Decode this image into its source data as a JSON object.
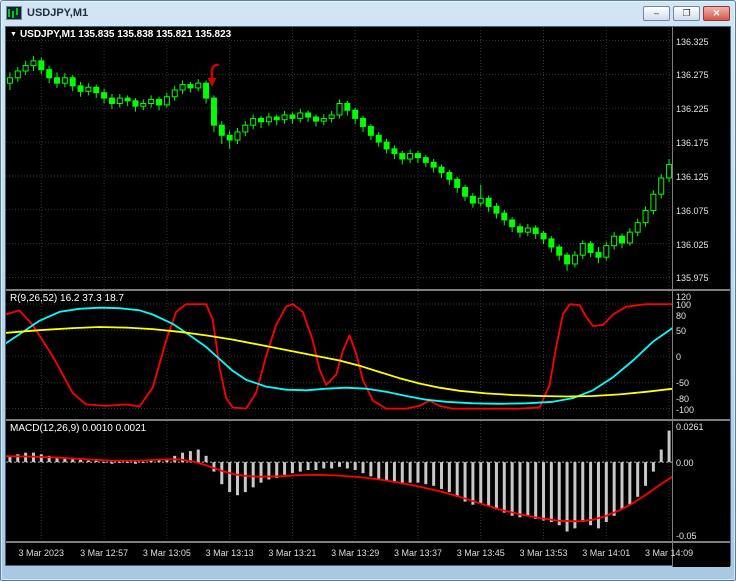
{
  "window": {
    "title": "USDJPY,M1",
    "minimize_label": "–",
    "restore_label": "❐",
    "close_label": "✕"
  },
  "chart": {
    "dropdown_icon": "▼",
    "header": "USDJPY,M1 135.835 135.838 135.821 135.823",
    "price_scale": [
      "136.325",
      "136.275",
      "136.225",
      "136.175",
      "136.125",
      "136.075",
      "136.025",
      "135.975"
    ],
    "time_labels": [
      "3 Mar 2023",
      "3 Mar 12:57",
      "3 Mar 13:05",
      "3 Mar 13:13",
      "3 Mar 13:21",
      "3 Mar 13:29",
      "3 Mar 13:37",
      "3 Mar 13:45",
      "3 Mar 13:53",
      "3 Mar 14:01",
      "3 Mar 14:09"
    ],
    "range": [
      135.958,
      136.345
    ],
    "colors": {
      "candle": "#00FF00",
      "grid": "#333333",
      "arrow": "#D40000"
    },
    "arrow": {
      "index": 26,
      "price": 136.292
    },
    "candles": [
      [
        136.262,
        136.278,
        136.252,
        136.27
      ],
      [
        136.27,
        136.286,
        136.264,
        136.28
      ],
      [
        136.28,
        136.295,
        136.274,
        136.288
      ],
      [
        136.288,
        136.302,
        136.28,
        136.295
      ],
      [
        136.295,
        136.3,
        136.275,
        136.282
      ],
      [
        136.282,
        136.288,
        136.262,
        136.27
      ],
      [
        136.27,
        136.278,
        136.255,
        136.262
      ],
      [
        136.262,
        136.277,
        136.256,
        136.27
      ],
      [
        136.27,
        136.274,
        136.25,
        136.258
      ],
      [
        136.258,
        136.264,
        136.242,
        136.25
      ],
      [
        136.25,
        136.262,
        136.244,
        136.256
      ],
      [
        136.256,
        136.26,
        136.24,
        136.248
      ],
      [
        136.248,
        136.254,
        136.232,
        136.24
      ],
      [
        136.24,
        136.246,
        136.224,
        136.232
      ],
      [
        136.232,
        136.246,
        136.226,
        136.24
      ],
      [
        136.24,
        136.244,
        136.228,
        136.236
      ],
      [
        136.236,
        136.24,
        136.22,
        136.228
      ],
      [
        136.228,
        136.238,
        136.222,
        136.232
      ],
      [
        136.232,
        136.244,
        136.226,
        136.238
      ],
      [
        136.238,
        136.242,
        136.222,
        136.23
      ],
      [
        136.23,
        136.248,
        136.226,
        136.242
      ],
      [
        136.242,
        136.258,
        136.236,
        136.252
      ],
      [
        136.252,
        136.266,
        136.246,
        136.26
      ],
      [
        136.26,
        136.264,
        136.248,
        136.255
      ],
      [
        136.255,
        136.268,
        136.25,
        136.262
      ],
      [
        136.262,
        136.266,
        136.232,
        136.24
      ],
      [
        136.24,
        136.244,
        136.19,
        136.2
      ],
      [
        136.2,
        136.206,
        136.172,
        136.185
      ],
      [
        136.185,
        136.192,
        136.165,
        136.178
      ],
      [
        136.178,
        136.196,
        136.172,
        136.19
      ],
      [
        136.19,
        136.206,
        136.184,
        136.2
      ],
      [
        136.2,
        136.216,
        136.194,
        136.21
      ],
      [
        136.21,
        136.214,
        136.196,
        136.205
      ],
      [
        136.205,
        136.218,
        136.199,
        136.212
      ],
      [
        136.212,
        136.216,
        136.2,
        136.208
      ],
      [
        136.208,
        136.221,
        136.202,
        136.215
      ],
      [
        136.215,
        136.219,
        136.202,
        136.21
      ],
      [
        136.21,
        136.224,
        136.204,
        136.218
      ],
      [
        136.218,
        136.222,
        136.205,
        136.212
      ],
      [
        136.212,
        136.216,
        136.198,
        136.206
      ],
      [
        136.206,
        136.216,
        136.2,
        136.21
      ],
      [
        136.21,
        136.221,
        136.204,
        136.215
      ],
      [
        136.215,
        136.238,
        136.21,
        136.232
      ],
      [
        136.232,
        136.236,
        136.214,
        136.222
      ],
      [
        136.222,
        136.226,
        136.202,
        136.21
      ],
      [
        136.21,
        136.214,
        136.19,
        136.198
      ],
      [
        136.198,
        136.202,
        136.178,
        136.185
      ],
      [
        136.185,
        136.19,
        136.168,
        136.175
      ],
      [
        136.175,
        136.18,
        136.158,
        136.165
      ],
      [
        136.165,
        136.17,
        136.15,
        136.158
      ],
      [
        136.158,
        136.162,
        136.142,
        136.15
      ],
      [
        136.15,
        136.164,
        136.144,
        136.158
      ],
      [
        136.158,
        136.162,
        136.144,
        136.152
      ],
      [
        136.152,
        136.156,
        136.138,
        136.145
      ],
      [
        136.145,
        136.15,
        136.13,
        136.138
      ],
      [
        136.138,
        136.142,
        136.122,
        136.13
      ],
      [
        136.13,
        136.134,
        136.112,
        136.12
      ],
      [
        136.12,
        136.124,
        136.1,
        136.108
      ],
      [
        136.108,
        136.112,
        136.088,
        136.095
      ],
      [
        136.095,
        136.1,
        136.078,
        136.085
      ],
      [
        136.085,
        136.112,
        136.08,
        136.092
      ],
      [
        136.092,
        136.096,
        136.072,
        136.08
      ],
      [
        136.08,
        136.085,
        136.062,
        136.07
      ],
      [
        136.07,
        136.075,
        136.052,
        136.06
      ],
      [
        136.06,
        136.064,
        136.042,
        136.05
      ],
      [
        136.05,
        136.055,
        136.034,
        136.042
      ],
      [
        136.042,
        136.054,
        136.036,
        136.048
      ],
      [
        136.048,
        136.052,
        136.032,
        136.04
      ],
      [
        136.04,
        136.044,
        136.024,
        136.032
      ],
      [
        136.032,
        136.036,
        136.012,
        136.02
      ],
      [
        136.02,
        136.024,
        136.0,
        136.008
      ],
      [
        136.008,
        136.012,
        135.985,
        135.995
      ],
      [
        135.995,
        136.014,
        135.99,
        136.008
      ],
      [
        136.008,
        136.03,
        136.002,
        136.025
      ],
      [
        136.025,
        136.029,
        136.005,
        136.012
      ],
      [
        136.012,
        136.02,
        135.996,
        136.005
      ],
      [
        136.005,
        136.028,
        136.0,
        136.022
      ],
      [
        136.022,
        136.042,
        136.016,
        136.036
      ],
      [
        136.036,
        136.04,
        136.018,
        136.026
      ],
      [
        136.026,
        136.048,
        136.022,
        136.042
      ],
      [
        136.042,
        136.062,
        136.036,
        136.056
      ],
      [
        136.056,
        136.08,
        136.05,
        136.074
      ],
      [
        136.074,
        136.104,
        136.068,
        136.098
      ],
      [
        136.098,
        136.128,
        136.092,
        136.122
      ],
      [
        136.122,
        136.15,
        136.116,
        136.142
      ]
    ]
  },
  "wpr": {
    "label": "R(9,26,52) 16.2 37.3 18.7",
    "scale": [
      "120",
      "100",
      "80",
      "50",
      "0",
      "-50",
      "-80",
      "-100"
    ],
    "gridlines": [
      100,
      50,
      0,
      -50,
      -100
    ],
    "range": [
      -120,
      125
    ],
    "lines": [
      {
        "name": "fast",
        "color": "#FF0000",
        "points": [
          [
            0,
            80
          ],
          [
            0.02,
            88
          ],
          [
            0.04,
            60
          ],
          [
            0.07,
            0
          ],
          [
            0.1,
            -70
          ],
          [
            0.12,
            -92
          ],
          [
            0.15,
            -95
          ],
          [
            0.18,
            -92
          ],
          [
            0.2,
            -96
          ],
          [
            0.22,
            -60
          ],
          [
            0.24,
            30
          ],
          [
            0.255,
            85
          ],
          [
            0.27,
            100
          ],
          [
            0.3,
            100
          ],
          [
            0.31,
            70
          ],
          [
            0.32,
            -20
          ],
          [
            0.33,
            -80
          ],
          [
            0.34,
            -98
          ],
          [
            0.36,
            -100
          ],
          [
            0.375,
            -70
          ],
          [
            0.39,
            0
          ],
          [
            0.405,
            60
          ],
          [
            0.42,
            95
          ],
          [
            0.43,
            100
          ],
          [
            0.445,
            85
          ],
          [
            0.46,
            30
          ],
          [
            0.47,
            -25
          ],
          [
            0.48,
            -55
          ],
          [
            0.495,
            -35
          ],
          [
            0.505,
            10
          ],
          [
            0.515,
            40
          ],
          [
            0.525,
            5
          ],
          [
            0.535,
            -45
          ],
          [
            0.55,
            -85
          ],
          [
            0.57,
            -100
          ],
          [
            0.6,
            -100
          ],
          [
            0.62,
            -95
          ],
          [
            0.635,
            -85
          ],
          [
            0.65,
            -95
          ],
          [
            0.67,
            -100
          ],
          [
            0.72,
            -100
          ],
          [
            0.77,
            -100
          ],
          [
            0.8,
            -98
          ],
          [
            0.815,
            -55
          ],
          [
            0.825,
            20
          ],
          [
            0.835,
            80
          ],
          [
            0.845,
            100
          ],
          [
            0.86,
            98
          ],
          [
            0.87,
            75
          ],
          [
            0.88,
            58
          ],
          [
            0.895,
            60
          ],
          [
            0.91,
            80
          ],
          [
            0.93,
            95
          ],
          [
            0.96,
            100
          ],
          [
            1,
            100
          ]
        ]
      },
      {
        "name": "mid",
        "color": "#00FFFF",
        "points": [
          [
            0,
            25
          ],
          [
            0.02,
            42
          ],
          [
            0.05,
            68
          ],
          [
            0.08,
            85
          ],
          [
            0.11,
            91
          ],
          [
            0.14,
            93
          ],
          [
            0.17,
            92
          ],
          [
            0.2,
            88
          ],
          [
            0.22,
            80
          ],
          [
            0.25,
            62
          ],
          [
            0.27,
            45
          ],
          [
            0.3,
            18
          ],
          [
            0.32,
            -5
          ],
          [
            0.34,
            -28
          ],
          [
            0.36,
            -45
          ],
          [
            0.39,
            -58
          ],
          [
            0.42,
            -64
          ],
          [
            0.45,
            -65
          ],
          [
            0.48,
            -62
          ],
          [
            0.51,
            -60
          ],
          [
            0.54,
            -62
          ],
          [
            0.57,
            -68
          ],
          [
            0.6,
            -76
          ],
          [
            0.63,
            -83
          ],
          [
            0.66,
            -87
          ],
          [
            0.7,
            -90
          ],
          [
            0.74,
            -91
          ],
          [
            0.78,
            -90
          ],
          [
            0.82,
            -87
          ],
          [
            0.85,
            -80
          ],
          [
            0.88,
            -65
          ],
          [
            0.91,
            -40
          ],
          [
            0.94,
            -8
          ],
          [
            0.97,
            28
          ],
          [
            1,
            55
          ]
        ]
      },
      {
        "name": "slow",
        "color": "#FFFF00",
        "points": [
          [
            0,
            45
          ],
          [
            0.05,
            50
          ],
          [
            0.1,
            54
          ],
          [
            0.14,
            56
          ],
          [
            0.18,
            55
          ],
          [
            0.22,
            52
          ],
          [
            0.26,
            47
          ],
          [
            0.3,
            40
          ],
          [
            0.34,
            32
          ],
          [
            0.38,
            22
          ],
          [
            0.42,
            12
          ],
          [
            0.46,
            2
          ],
          [
            0.5,
            -8
          ],
          [
            0.53,
            -18
          ],
          [
            0.56,
            -30
          ],
          [
            0.59,
            -42
          ],
          [
            0.62,
            -52
          ],
          [
            0.65,
            -60
          ],
          [
            0.68,
            -66
          ],
          [
            0.72,
            -71
          ],
          [
            0.76,
            -74
          ],
          [
            0.8,
            -76
          ],
          [
            0.84,
            -77
          ],
          [
            0.88,
            -76
          ],
          [
            0.92,
            -73
          ],
          [
            0.96,
            -68
          ],
          [
            1,
            -62
          ]
        ]
      }
    ]
  },
  "macd": {
    "label": "MACD(12,26,9) 0.0010 0.0021",
    "scale": [
      "0.0261",
      "0.00",
      "-0.05"
    ],
    "range": [
      -0.05,
      0.0261
    ],
    "hist_color": "#C8C8C8",
    "histogram": [
      0.004,
      0.005,
      0.006,
      0.006,
      0.005,
      0.004,
      0.003,
      0.003,
      0.002,
      0.002,
      0.001,
      0.001,
      0,
      -0.001,
      0,
      0,
      -0.001,
      0,
      0.001,
      0.001,
      0.002,
      0.004,
      0.006,
      0.007,
      0.008,
      0.004,
      -0.006,
      -0.014,
      -0.019,
      -0.021,
      -0.019,
      -0.016,
      -0.013,
      -0.011,
      -0.01,
      -0.008,
      -0.007,
      -0.006,
      -0.005,
      -0.005,
      -0.004,
      -0.004,
      -0.003,
      -0.004,
      -0.005,
      -0.007,
      -0.009,
      -0.011,
      -0.012,
      -0.013,
      -0.014,
      -0.013,
      -0.013,
      -0.014,
      -0.015,
      -0.017,
      -0.019,
      -0.022,
      -0.025,
      -0.027,
      -0.026,
      -0.028,
      -0.03,
      -0.032,
      -0.034,
      -0.035,
      -0.034,
      -0.036,
      -0.037,
      -0.038,
      -0.04,
      -0.044,
      -0.042,
      -0.038,
      -0.04,
      -0.042,
      -0.038,
      -0.034,
      -0.03,
      -0.027,
      -0.022,
      -0.015,
      -0.006,
      0.008,
      0.02
    ],
    "signal": {
      "color": "#FF0000",
      "points": [
        [
          0,
          0.0038
        ],
        [
          0.04,
          0.0035
        ],
        [
          0.08,
          0.0028
        ],
        [
          0.12,
          0.0018
        ],
        [
          0.16,
          0.001
        ],
        [
          0.2,
          0.001
        ],
        [
          0.23,
          0.0016
        ],
        [
          0.26,
          0.0018
        ],
        [
          0.28,
          0.0005
        ],
        [
          0.3,
          -0.002
        ],
        [
          0.32,
          -0.005
        ],
        [
          0.34,
          -0.0075
        ],
        [
          0.36,
          -0.0088
        ],
        [
          0.38,
          -0.0092
        ],
        [
          0.41,
          -0.009
        ],
        [
          0.44,
          -0.0082
        ],
        [
          0.47,
          -0.008
        ],
        [
          0.5,
          -0.0085
        ],
        [
          0.53,
          -0.0095
        ],
        [
          0.56,
          -0.011
        ],
        [
          0.59,
          -0.013
        ],
        [
          0.62,
          -0.0155
        ],
        [
          0.65,
          -0.0185
        ],
        [
          0.68,
          -0.022
        ],
        [
          0.71,
          -0.026
        ],
        [
          0.74,
          -0.03
        ],
        [
          0.77,
          -0.033
        ],
        [
          0.8,
          -0.0355
        ],
        [
          0.83,
          -0.0372
        ],
        [
          0.86,
          -0.0375
        ],
        [
          0.88,
          -0.0365
        ],
        [
          0.9,
          -0.034
        ],
        [
          0.92,
          -0.0305
        ],
        [
          0.94,
          -0.026
        ],
        [
          0.96,
          -0.0205
        ],
        [
          0.98,
          -0.0145
        ],
        [
          1,
          -0.009
        ]
      ]
    }
  }
}
